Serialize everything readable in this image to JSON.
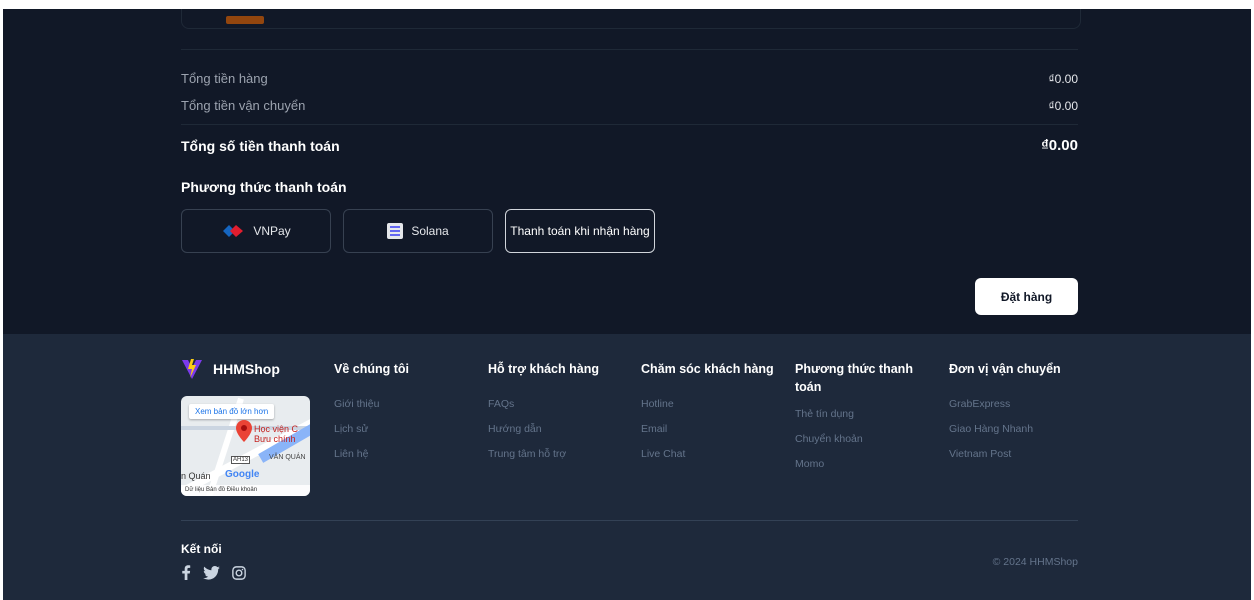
{
  "summary": {
    "subtotal_label": "Tổng tiền hàng",
    "subtotal_value": "₫0.00",
    "shipping_label": "Tổng tiền vận chuyển",
    "shipping_value": "₫0.00",
    "total_label": "Tổng số tiền thanh toán",
    "total_value": "₫0.00"
  },
  "payment": {
    "title": "Phương thức thanh toán",
    "methods": [
      {
        "label": "VNPay",
        "icon": "vnpay-logo-icon",
        "selected": false
      },
      {
        "label": "Solana",
        "icon": "solana-logo-icon",
        "selected": false
      },
      {
        "label": "Thanh toán khi nhận hàng",
        "icon": "",
        "selected": true
      }
    ]
  },
  "order_button": "Đặt hàng",
  "footer": {
    "brand": "HHMShop",
    "map": {
      "larger_map_link": "Xem bản đồ lớn hơn",
      "place_line1": "Học viện C",
      "place_line2": "Bưu chính",
      "district": "VĂN QUÁN",
      "district2": "n Quán",
      "road_label": "AH13",
      "provider": "Google",
      "attribution": "Dữ liệu Bản đồ   Điều khoản"
    },
    "columns": [
      {
        "title": "Về chúng tôi",
        "items": [
          "Giới thiệu",
          "Lịch sử",
          "Liên hệ"
        ]
      },
      {
        "title": "Hỗ trợ khách hàng",
        "items": [
          "FAQs",
          "Hướng dẫn",
          "Trung tâm hỗ trợ"
        ]
      },
      {
        "title": "Chăm sóc khách hàng",
        "items": [
          "Hotline",
          "Email",
          "Live Chat"
        ]
      },
      {
        "title": "Phương thức thanh toán",
        "items": [
          "Thẻ tín dụng",
          "Chuyển khoản",
          "Momo"
        ]
      },
      {
        "title": "Đơn vị vận chuyển",
        "items": [
          "GrabExpress",
          "Giao Hàng Nhanh",
          "Vietnam Post"
        ]
      }
    ],
    "connect_label": "Kết nối",
    "socials": [
      "facebook-icon",
      "twitter-icon",
      "instagram-icon"
    ],
    "copyright": "© 2024 HHMShop"
  },
  "colors": {
    "page_bg": "#111827",
    "footer_bg": "#1e293b",
    "button_bg": "#ffffff",
    "vnpay_red": "#e11d2e",
    "vnpay_blue": "#1565c0",
    "brand_logo_purple": "#7c3aed",
    "brand_logo_yellow": "#facc15"
  }
}
